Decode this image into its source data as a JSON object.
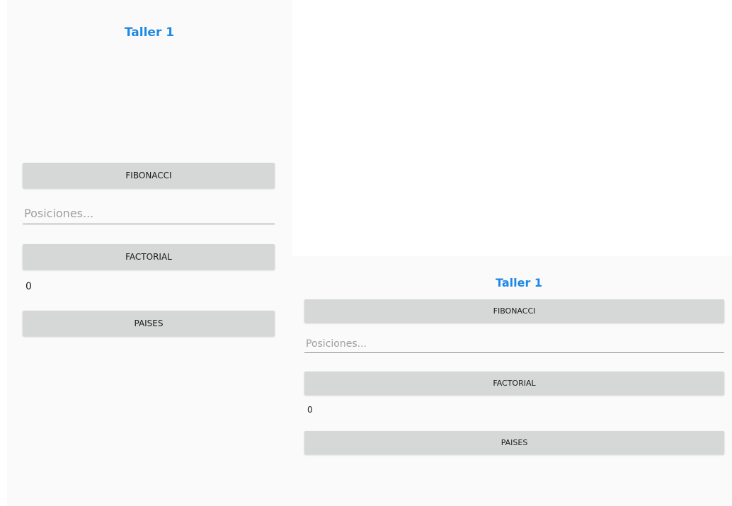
{
  "portrait": {
    "title": "Taller 1",
    "fibonacci_label": "FIBONACCI",
    "positions_placeholder": "Posiciones...",
    "positions_value": "",
    "factorial_label": "FACTORIAL",
    "result_text": "0",
    "paises_label": "PAISES"
  },
  "landscape": {
    "title": "Taller 1",
    "fibonacci_label": "FIBONACCI",
    "positions_placeholder": "Posiciones...",
    "positions_value": "",
    "factorial_label": "FACTORIAL",
    "result_text": "0",
    "paises_label": "PAISES"
  },
  "colors": {
    "title": "#1e88e5",
    "button_bg": "#d6d7d7",
    "screen_bg": "#fafafa",
    "page_bg": "#ffffff"
  }
}
